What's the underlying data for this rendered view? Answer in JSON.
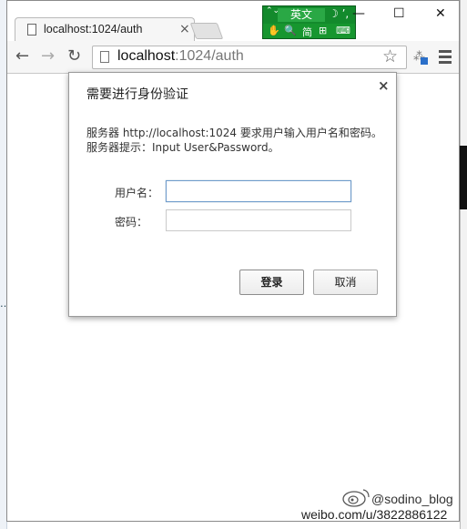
{
  "browser": {
    "tab_title": "localhost:1024/auth",
    "tab_close": "×",
    "window_controls": {
      "minimize": "—",
      "maximize": "☐",
      "close": "✕"
    },
    "nav": {
      "back": "←",
      "forward": "→",
      "reload": "↻"
    },
    "url_host": "localhost",
    "url_rest": ":1024/auth",
    "bookmark_star": "☆"
  },
  "ime": {
    "mode_label": "英文",
    "arrows": "⌃⌄",
    "punct": "☽ ’,",
    "bottom_items": {
      "hand": "✋",
      "search": "🔍",
      "simplified": "简",
      "layout": "⊞",
      "keyboard": "⌨"
    }
  },
  "auth_dialog": {
    "title": "需要进行身份验证",
    "close": "×",
    "message_line1": "服务器 http://localhost:1024 要求用户输入用户名和密码。",
    "message_line2": "服务器提示：Input User&Password。",
    "username_label": "用户名：",
    "username_value": "",
    "password_label": "密码：",
    "password_value": "",
    "login_button": "登录",
    "cancel_button": "取消"
  },
  "watermark": {
    "account": "@sodino_blog",
    "url": "weibo.com/u/3822886122"
  }
}
